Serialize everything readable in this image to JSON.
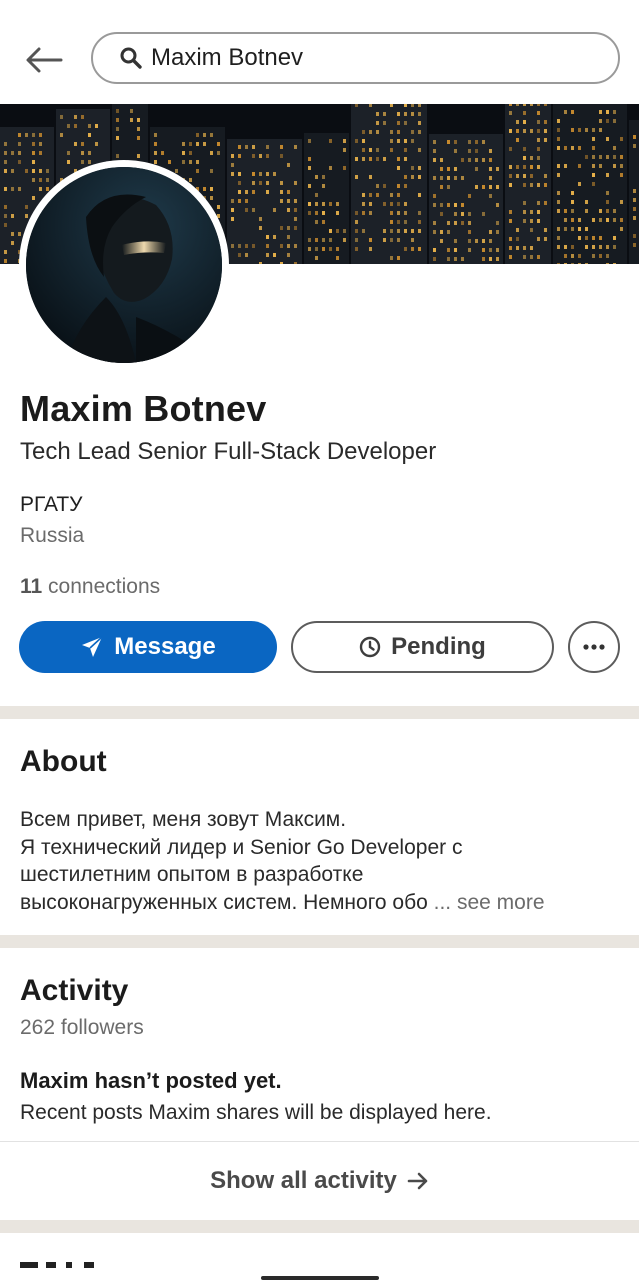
{
  "search": {
    "query": "Maxim Botnev"
  },
  "profile": {
    "name": "Maxim Botnev",
    "headline": "Tech Lead Senior Full-Stack Developer",
    "school": "РГАТУ",
    "location": "Russia",
    "connections_count": "11",
    "connections_label": "connections"
  },
  "actions": {
    "message_label": "Message",
    "pending_label": "Pending"
  },
  "about": {
    "title": "About",
    "lines": [
      "Всем привет, меня зовут Максим.",
      "Я технический лидер и Senior Go Developer с",
      "шестилетним опытом в разработке",
      "высоконагруженных систем. Немного обо"
    ],
    "see_more": "... see more"
  },
  "activity": {
    "title": "Activity",
    "followers": "262 followers",
    "empty_title": "Maxim hasn’t posted yet.",
    "empty_subtitle": "Recent posts Maxim shares will be displayed here.",
    "show_all_label": "Show all activity"
  },
  "colors": {
    "primary": "#0a66c2",
    "divider": "#e9e5df",
    "muted_text": "#6b6b6b"
  },
  "icons": {
    "back": "arrow-left-icon",
    "search": "search-icon",
    "message": "send-icon",
    "pending": "clock-icon",
    "more": "ellipsis-icon",
    "show_all": "arrow-right-icon"
  }
}
